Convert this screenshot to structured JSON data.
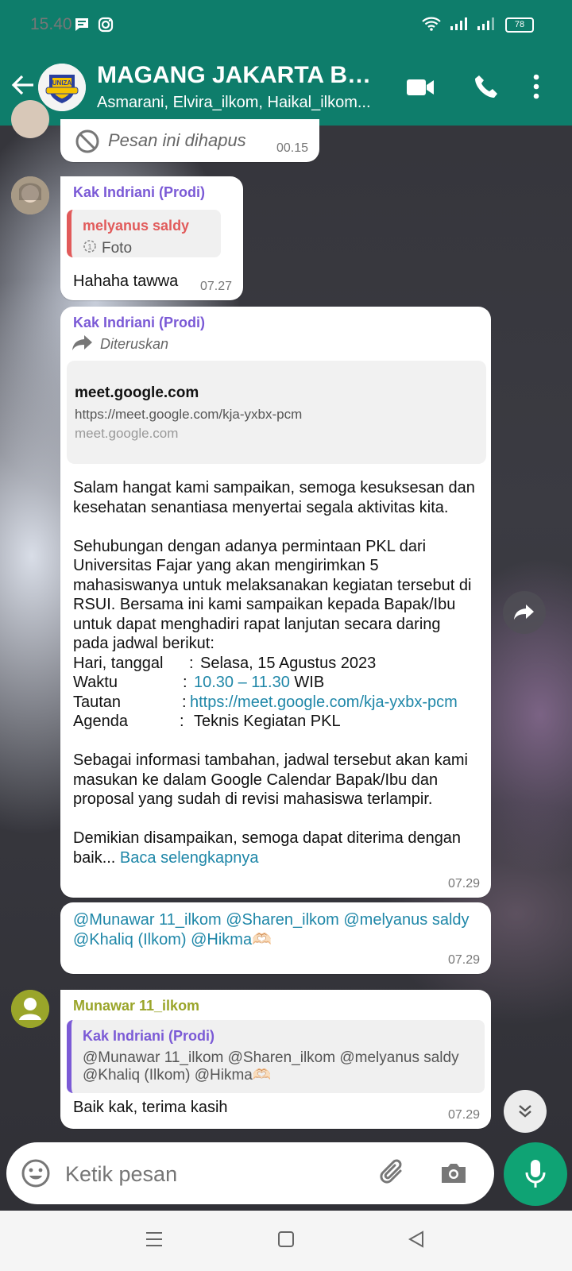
{
  "status": {
    "time": "15.40",
    "battery": "78"
  },
  "header": {
    "title": "MAGANG JAKARTA BA...",
    "subtitle": "Asmarani, Elvira_ilkom, Haikal_ilkom...",
    "avatar_text": "UNIZA"
  },
  "messages": {
    "deleted": {
      "text": "Pesan ini dihapus",
      "time": "00.15"
    },
    "m1": {
      "sender": "Kak Indriani (Prodi)",
      "quote_sender": "melyanus saldy",
      "quote_text": "Foto",
      "text": "Hahaha tawwa",
      "time": "07.27"
    },
    "m2": {
      "sender": "Kak Indriani (Prodi)",
      "forwarded": "Diteruskan",
      "preview_title": "meet.google.com",
      "preview_url": "https://meet.google.com/kja-yxbx-pcm",
      "preview_domain": "meet.google.com",
      "p1": "Salam hangat kami sampaikan, semoga kesuksesan dan kesehatan senantiasa menyertai segala aktivitas kita.",
      "p2": "Sehubungan dengan adanya permintaan PKL dari Universitas Fajar yang akan mengirimkan 5 mahasiswanya untuk melaksanakan kegiatan tersebut di RSUI. Bersama ini kami sampaikan kepada Bapak/Ibu untuk dapat menghadiri rapat lanjutan secara daring pada jadwal berikut:",
      "row1_label": "Hari, tanggal",
      "row1_value": "Selasa, 15 Agustus 2023",
      "row2_label": "Waktu",
      "row2_value": "10.30 – 11.30",
      "row2_suffix": "WIB",
      "row3_label": "Tautan",
      "row3_value": "https://meet.google.com/kja-yxbx-pcm",
      "row4_label": "Agenda",
      "row4_value": "Teknis Kegiatan PKL",
      "p3": "Sebagai informasi tambahan, jadwal tersebut akan kami masukan ke dalam Google Calendar Bapak/Ibu dan proposal yang sudah di revisi mahasiswa terlampir.",
      "p4": "Demikian disampaikan, semoga dapat diterima dengan baik...",
      "read_more": "Baca selengkapnya",
      "time": "07.29"
    },
    "m3": {
      "text": "@Munawar 11_ilkom @Sharen_ilkom @melyanus saldy @Khaliq (Ilkom) @Hikma🫶🏻",
      "time": "07.29"
    },
    "m4": {
      "sender": "Munawar 11_ilkom",
      "quote_sender": "Kak Indriani (Prodi)",
      "quote_text": "@Munawar 11_ilkom @Sharen_ilkom @melyanus saldy @Khaliq (Ilkom) @Hikma🫶🏻",
      "text": "Baik kak, terima kasih",
      "time": "07.29"
    }
  },
  "input": {
    "placeholder": "Ketik pesan"
  },
  "colors": {
    "header": "#0e7d6b",
    "sender_purple": "#7b5ad6",
    "sender_olive": "#9aa52a",
    "quote_red": "#e15a5a",
    "link": "#1f87a8",
    "mic": "#0fa374"
  }
}
